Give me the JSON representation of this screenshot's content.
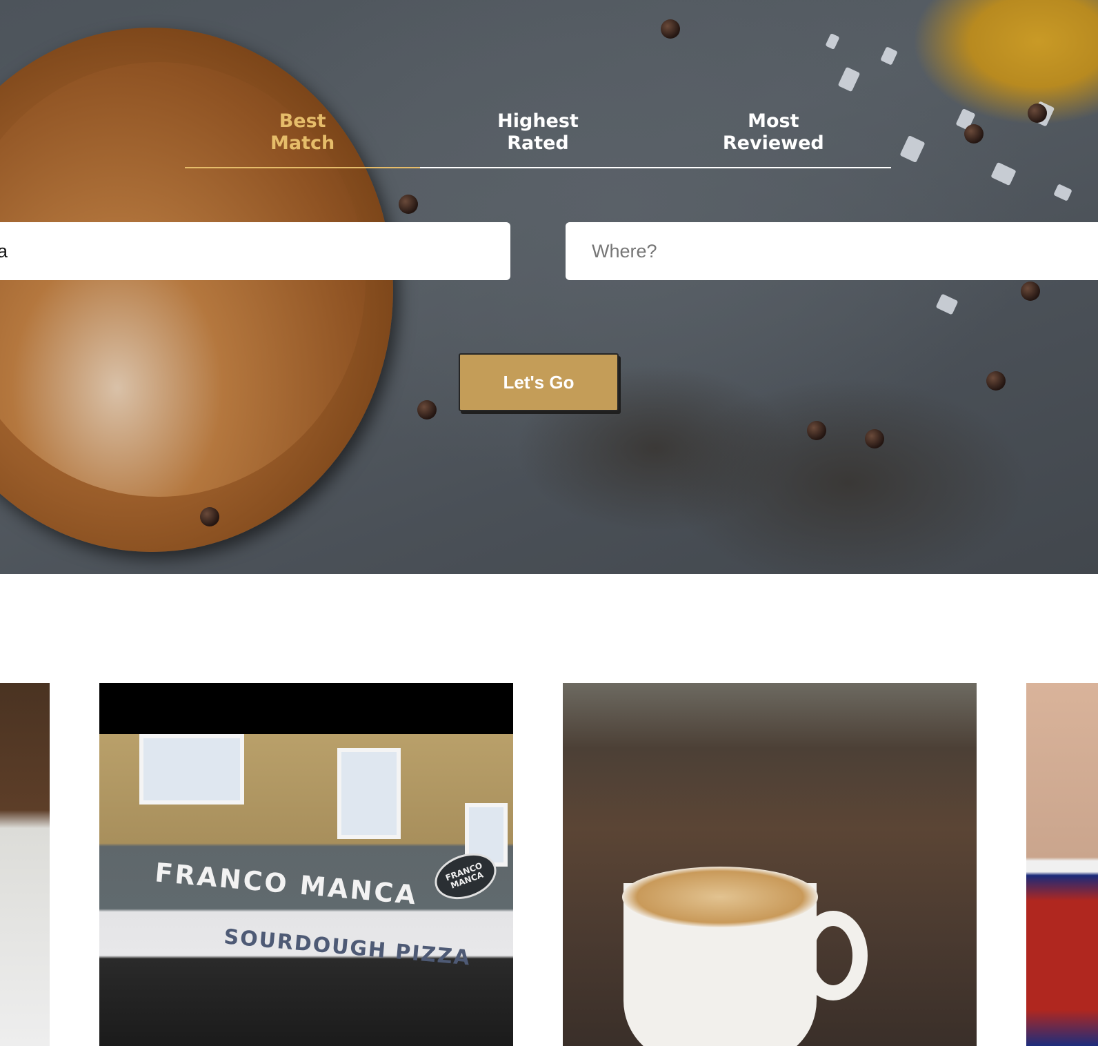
{
  "tabs": [
    {
      "label_line1": "Best",
      "label_line2": "Match",
      "active": true
    },
    {
      "label_line1": "Highest",
      "label_line2": "Rated",
      "active": false
    },
    {
      "label_line1": "Most",
      "label_line2": "Reviewed",
      "active": false
    }
  ],
  "search": {
    "what_value": "a",
    "where_placeholder": "Where?"
  },
  "go_button_label": "Let's Go",
  "cards": [
    {
      "image": "restaurant-plate-photo"
    },
    {
      "image": "storefront-photo",
      "sign_text": "FRANCO MANCA",
      "sub_text": "SOURDOUGH PIZZA",
      "badge_text": "FRANCO MANCA"
    },
    {
      "image": "coffee-latte-photo"
    },
    {
      "image": "diner-interior-photo"
    }
  ],
  "colors": {
    "accent": "#e6bd6a",
    "button": "#c49d58"
  }
}
